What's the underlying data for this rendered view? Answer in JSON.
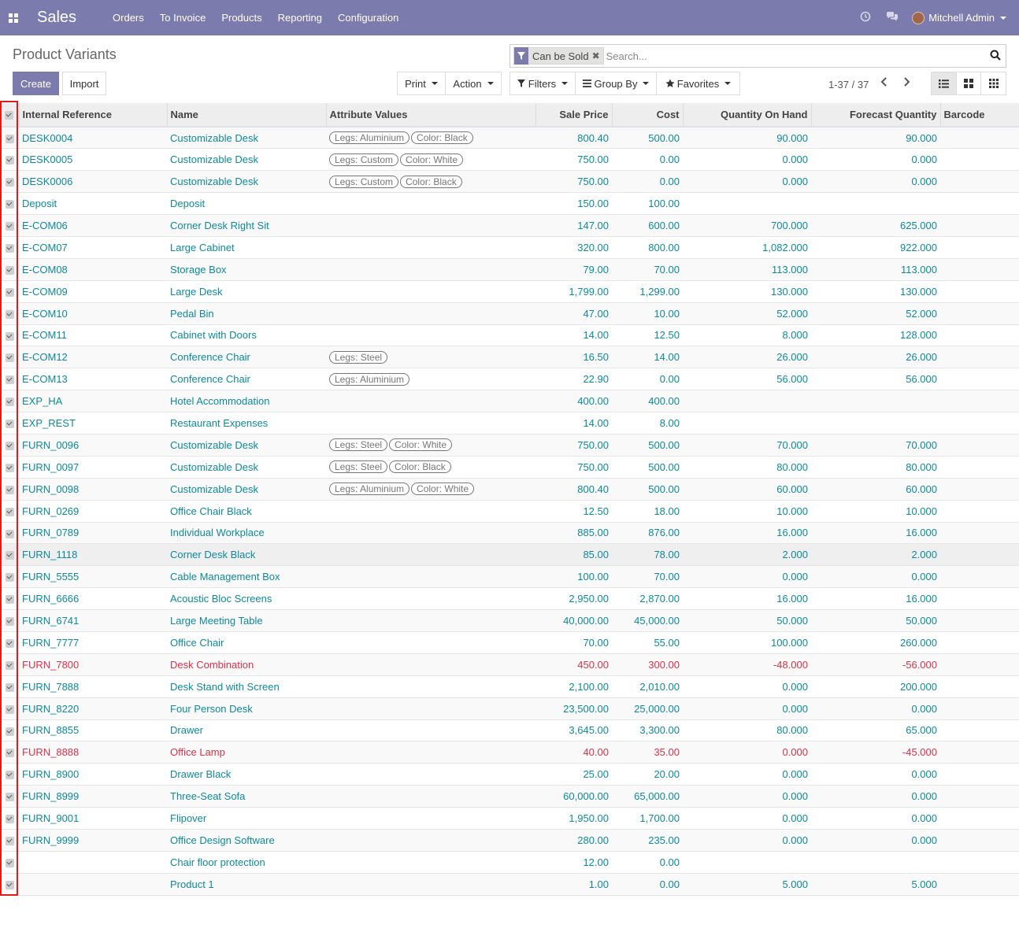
{
  "navbar": {
    "app_name": "Sales",
    "menu": [
      "Orders",
      "To Invoice",
      "Products",
      "Reporting",
      "Configuration"
    ],
    "user_name": "Mitchell Admin",
    "bg_color": "#7c7bad",
    "icons": [
      "apps-grid-icon",
      "clock-icon",
      "chat-icon"
    ]
  },
  "control_panel": {
    "title": "Product Variants",
    "create_label": "Create",
    "import_label": "Import",
    "print_label": "Print",
    "action_label": "Action",
    "filters_label": "Filters",
    "groupby_label": "Group By",
    "favorites_label": "Favorites",
    "search_facet": "Can be Sold",
    "search_placeholder": "Search...",
    "pager": "1-37 / 37"
  },
  "table": {
    "headers": [
      "Internal Reference",
      "Name",
      "Attribute Values",
      "Sale Price",
      "Cost",
      "Quantity On Hand",
      "Forecast Quantity",
      "Barcode"
    ],
    "rows": [
      {
        "ref": "DESK0004",
        "name": "Customizable Desk",
        "tags": [
          "Legs: Aluminium",
          "Color: Black"
        ],
        "price": "800.40",
        "cost": "500.00",
        "qty": "90.000",
        "forecast": "90.000",
        "barcode": ""
      },
      {
        "ref": "DESK0005",
        "name": "Customizable Desk",
        "tags": [
          "Legs: Custom",
          "Color: White"
        ],
        "price": "750.00",
        "cost": "0.00",
        "qty": "0.000",
        "forecast": "0.000",
        "barcode": ""
      },
      {
        "ref": "DESK0006",
        "name": "Customizable Desk",
        "tags": [
          "Legs: Custom",
          "Color: Black"
        ],
        "price": "750.00",
        "cost": "0.00",
        "qty": "0.000",
        "forecast": "0.000",
        "barcode": ""
      },
      {
        "ref": "Deposit",
        "name": "Deposit",
        "tags": [],
        "price": "150.00",
        "cost": "100.00",
        "qty": "",
        "forecast": "",
        "barcode": ""
      },
      {
        "ref": "E-COM06",
        "name": "Corner Desk Right Sit",
        "tags": [],
        "price": "147.00",
        "cost": "600.00",
        "qty": "700.000",
        "forecast": "625.000",
        "barcode": ""
      },
      {
        "ref": "E-COM07",
        "name": "Large Cabinet",
        "tags": [],
        "price": "320.00",
        "cost": "800.00",
        "qty": "1,082.000",
        "forecast": "922.000",
        "barcode": ""
      },
      {
        "ref": "E-COM08",
        "name": "Storage Box",
        "tags": [],
        "price": "79.00",
        "cost": "70.00",
        "qty": "113.000",
        "forecast": "113.000",
        "barcode": ""
      },
      {
        "ref": "E-COM09",
        "name": "Large Desk",
        "tags": [],
        "price": "1,799.00",
        "cost": "1,299.00",
        "qty": "130.000",
        "forecast": "130.000",
        "barcode": ""
      },
      {
        "ref": "E-COM10",
        "name": "Pedal Bin",
        "tags": [],
        "price": "47.00",
        "cost": "10.00",
        "qty": "52.000",
        "forecast": "52.000",
        "barcode": ""
      },
      {
        "ref": "E-COM11",
        "name": "Cabinet with Doors",
        "tags": [],
        "price": "14.00",
        "cost": "12.50",
        "qty": "8.000",
        "forecast": "128.000",
        "barcode": ""
      },
      {
        "ref": "E-COM12",
        "name": "Conference Chair",
        "tags": [
          "Legs: Steel"
        ],
        "price": "16.50",
        "cost": "14.00",
        "qty": "26.000",
        "forecast": "26.000",
        "barcode": ""
      },
      {
        "ref": "E-COM13",
        "name": "Conference Chair",
        "tags": [
          "Legs: Aluminium"
        ],
        "price": "22.90",
        "cost": "0.00",
        "qty": "56.000",
        "forecast": "56.000",
        "barcode": ""
      },
      {
        "ref": "EXP_HA",
        "name": "Hotel Accommodation",
        "tags": [],
        "price": "400.00",
        "cost": "400.00",
        "qty": "",
        "forecast": "",
        "barcode": ""
      },
      {
        "ref": "EXP_REST",
        "name": "Restaurant Expenses",
        "tags": [],
        "price": "14.00",
        "cost": "8.00",
        "qty": "",
        "forecast": "",
        "barcode": ""
      },
      {
        "ref": "FURN_0096",
        "name": "Customizable Desk",
        "tags": [
          "Legs: Steel",
          "Color: White"
        ],
        "price": "750.00",
        "cost": "500.00",
        "qty": "70.000",
        "forecast": "70.000",
        "barcode": ""
      },
      {
        "ref": "FURN_0097",
        "name": "Customizable Desk",
        "tags": [
          "Legs: Steel",
          "Color: Black"
        ],
        "price": "750.00",
        "cost": "500.00",
        "qty": "80.000",
        "forecast": "80.000",
        "barcode": ""
      },
      {
        "ref": "FURN_0098",
        "name": "Customizable Desk",
        "tags": [
          "Legs: Aluminium",
          "Color: White"
        ],
        "price": "800.40",
        "cost": "500.00",
        "qty": "60.000",
        "forecast": "60.000",
        "barcode": ""
      },
      {
        "ref": "FURN_0269",
        "name": "Office Chair Black",
        "tags": [],
        "price": "12.50",
        "cost": "18.00",
        "qty": "10.000",
        "forecast": "10.000",
        "barcode": ""
      },
      {
        "ref": "FURN_0789",
        "name": "Individual Workplace",
        "tags": [],
        "price": "885.00",
        "cost": "876.00",
        "qty": "16.000",
        "forecast": "16.000",
        "barcode": ""
      },
      {
        "ref": "FURN_1118",
        "name": "Corner Desk Black",
        "tags": [],
        "price": "85.00",
        "cost": "78.00",
        "qty": "2.000",
        "forecast": "2.000",
        "barcode": "",
        "hovered": true
      },
      {
        "ref": "FURN_5555",
        "name": "Cable Management Box",
        "tags": [],
        "price": "100.00",
        "cost": "70.00",
        "qty": "0.000",
        "forecast": "0.000",
        "barcode": ""
      },
      {
        "ref": "FURN_6666",
        "name": "Acoustic Bloc Screens",
        "tags": [],
        "price": "2,950.00",
        "cost": "2,870.00",
        "qty": "16.000",
        "forecast": "16.000",
        "barcode": ""
      },
      {
        "ref": "FURN_6741",
        "name": "Large Meeting Table",
        "tags": [],
        "price": "40,000.00",
        "cost": "45,000.00",
        "qty": "50.000",
        "forecast": "50.000",
        "barcode": ""
      },
      {
        "ref": "FURN_7777",
        "name": "Office Chair",
        "tags": [],
        "price": "70.00",
        "cost": "55.00",
        "qty": "100.000",
        "forecast": "260.000",
        "barcode": ""
      },
      {
        "ref": "FURN_7800",
        "name": "Desk Combination",
        "tags": [],
        "price": "450.00",
        "cost": "300.00",
        "qty": "-48.000",
        "forecast": "-56.000",
        "barcode": "",
        "danger": true
      },
      {
        "ref": "FURN_7888",
        "name": "Desk Stand with Screen",
        "tags": [],
        "price": "2,100.00",
        "cost": "2,010.00",
        "qty": "0.000",
        "forecast": "200.000",
        "barcode": ""
      },
      {
        "ref": "FURN_8220",
        "name": "Four Person Desk",
        "tags": [],
        "price": "23,500.00",
        "cost": "25,000.00",
        "qty": "0.000",
        "forecast": "0.000",
        "barcode": ""
      },
      {
        "ref": "FURN_8855",
        "name": "Drawer",
        "tags": [],
        "price": "3,645.00",
        "cost": "3,300.00",
        "qty": "80.000",
        "forecast": "65.000",
        "barcode": ""
      },
      {
        "ref": "FURN_8888",
        "name": "Office Lamp",
        "tags": [],
        "price": "40.00",
        "cost": "35.00",
        "qty": "0.000",
        "forecast": "-45.000",
        "barcode": "",
        "danger": true
      },
      {
        "ref": "FURN_8900",
        "name": "Drawer Black",
        "tags": [],
        "price": "25.00",
        "cost": "20.00",
        "qty": "0.000",
        "forecast": "0.000",
        "barcode": ""
      },
      {
        "ref": "FURN_8999",
        "name": "Three-Seat Sofa",
        "tags": [],
        "price": "60,000.00",
        "cost": "65,000.00",
        "qty": "0.000",
        "forecast": "0.000",
        "barcode": ""
      },
      {
        "ref": "FURN_9001",
        "name": "Flipover",
        "tags": [],
        "price": "1,950.00",
        "cost": "1,700.00",
        "qty": "0.000",
        "forecast": "0.000",
        "barcode": ""
      },
      {
        "ref": "FURN_9999",
        "name": "Office Design Software",
        "tags": [],
        "price": "280.00",
        "cost": "235.00",
        "qty": "0.000",
        "forecast": "0.000",
        "barcode": ""
      },
      {
        "ref": "",
        "name": "Chair floor protection",
        "tags": [],
        "price": "12.00",
        "cost": "0.00",
        "qty": "",
        "forecast": "",
        "barcode": ""
      },
      {
        "ref": "",
        "name": "Product 1",
        "tags": [],
        "price": "1.00",
        "cost": "0.00",
        "qty": "5.000",
        "forecast": "5.000",
        "barcode": ""
      }
    ]
  },
  "colors": {
    "accent": "#7c7bad",
    "link": "#0d8a9c",
    "danger": "#d9324b",
    "highlight_box": "#e01b1b"
  }
}
